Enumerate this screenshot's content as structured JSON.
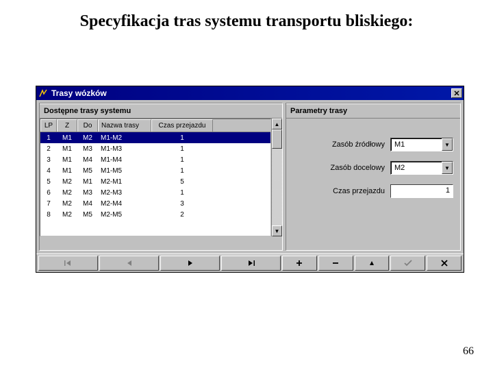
{
  "page": {
    "heading": "Specyfikacja tras systemu transportu bliskiego:",
    "page_number": "66"
  },
  "window": {
    "title": "Trasy wózków",
    "left_pane_title": "Dostępne trasy systemu",
    "right_pane_title": "Parametry trasy"
  },
  "grid": {
    "columns": {
      "lp": "LP",
      "z": "Z",
      "do": "Do",
      "name": "Nazwa trasy",
      "czas": "Czas przejazdu"
    },
    "rows": [
      {
        "lp": "1",
        "z": "M1",
        "do": "M2",
        "name": "M1-M2",
        "czas": "1",
        "selected": true
      },
      {
        "lp": "2",
        "z": "M1",
        "do": "M3",
        "name": "M1-M3",
        "czas": "1",
        "selected": false
      },
      {
        "lp": "3",
        "z": "M1",
        "do": "M4",
        "name": "M1-M4",
        "czas": "1",
        "selected": false
      },
      {
        "lp": "4",
        "z": "M1",
        "do": "M5",
        "name": "M1-M5",
        "czas": "1",
        "selected": false
      },
      {
        "lp": "5",
        "z": "M2",
        "do": "M1",
        "name": "M2-M1",
        "czas": "5",
        "selected": false
      },
      {
        "lp": "6",
        "z": "M2",
        "do": "M3",
        "name": "M2-M3",
        "czas": "1",
        "selected": false
      },
      {
        "lp": "7",
        "z": "M2",
        "do": "M4",
        "name": "M2-M4",
        "czas": "3",
        "selected": false
      },
      {
        "lp": "8",
        "z": "M2",
        "do": "M5",
        "name": "M2-M5",
        "czas": "2",
        "selected": false
      }
    ]
  },
  "form": {
    "source_label": "Zasób źródłowy",
    "source_value": "M1",
    "dest_label": "Zasób docelowy",
    "dest_value": "M2",
    "time_label": "Czas przejazdu",
    "time_value": "1"
  },
  "nav": {
    "first": "▏◄",
    "prev": "◄",
    "next": "►",
    "last": "►▕"
  },
  "edit": {
    "add": "+",
    "remove": "−",
    "edit": "▲",
    "confirm": "✓",
    "cancel": "✕"
  }
}
